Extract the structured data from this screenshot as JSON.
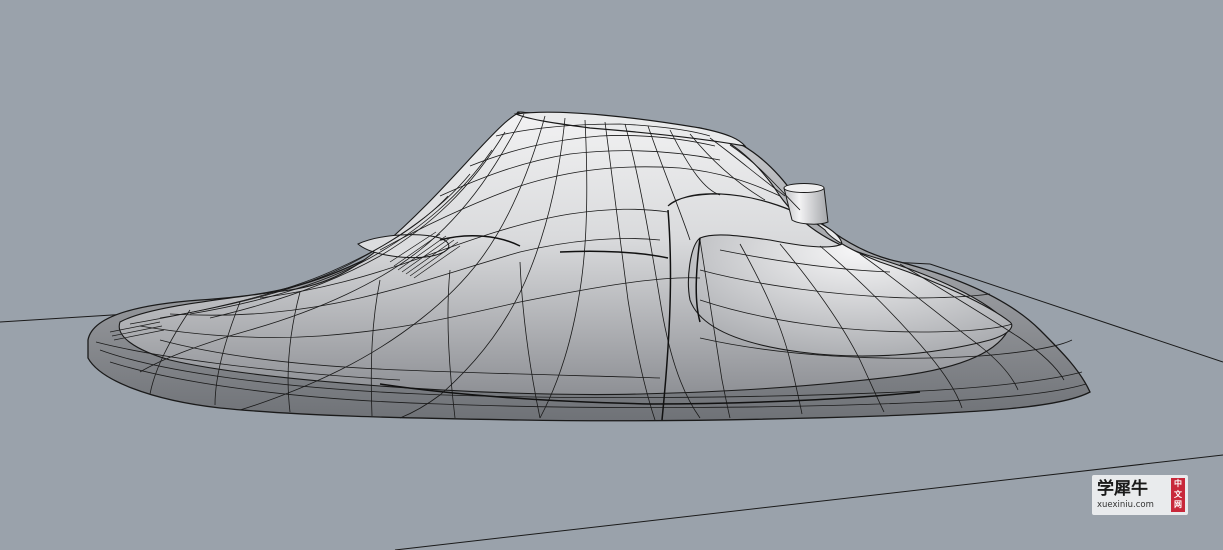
{
  "viewport": {
    "background_color": "#9aa2ab",
    "surface_color": "#d6d7d9",
    "wire_color": "#1c1c1c"
  },
  "watermark": {
    "title": "学犀牛",
    "url": "xuexiniu.com",
    "badge_chars": [
      "中",
      "文",
      "网"
    ],
    "badge_color": "#c8283a"
  }
}
